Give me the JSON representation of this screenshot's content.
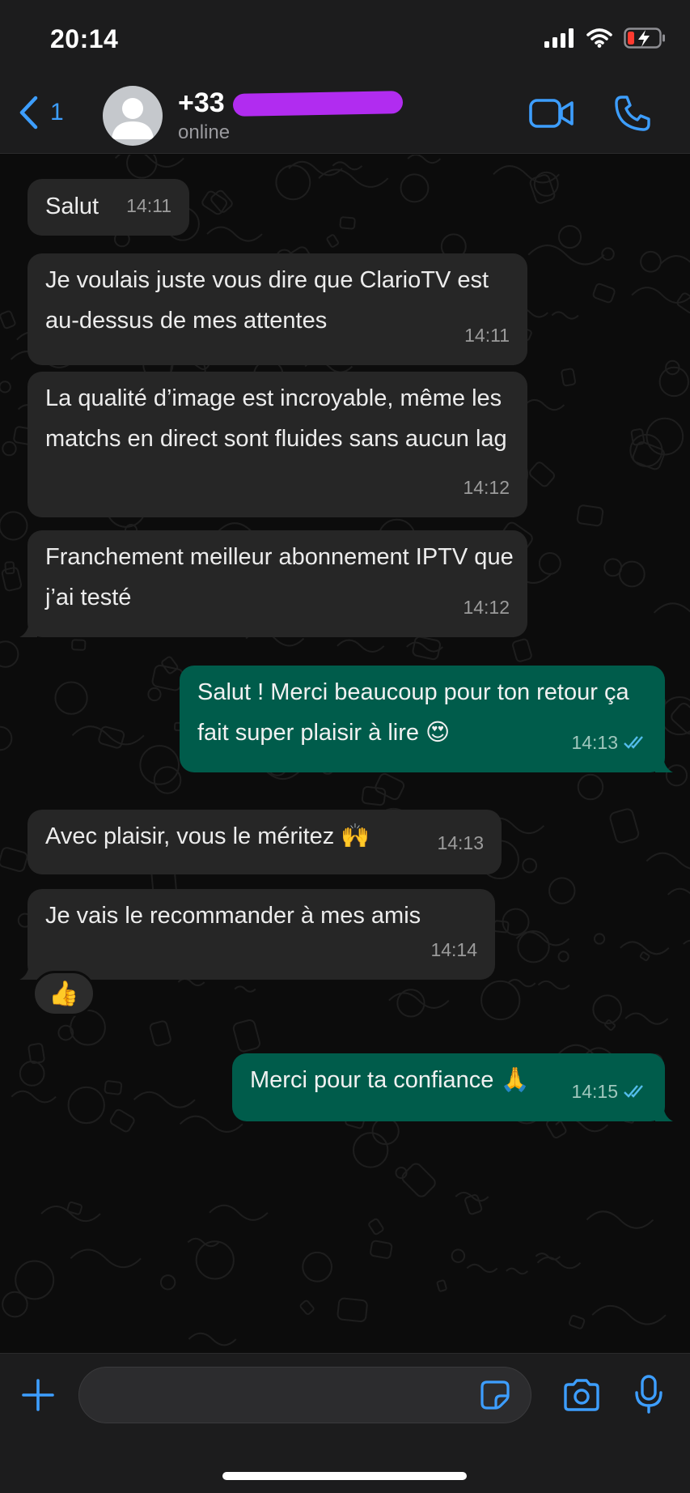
{
  "status_bar": {
    "time": "20:14"
  },
  "header": {
    "back_count": "1",
    "contact_name": "+33",
    "contact_status": "online"
  },
  "messages": [
    {
      "direction": "in",
      "text": "Salut",
      "time": "14:11"
    },
    {
      "direction": "in",
      "text": "Je voulais juste vous dire que ClarioTV est au-dessus de mes attentes",
      "time": "14:11"
    },
    {
      "direction": "in",
      "text": "La qualité d’image est incroyable, même les matchs en direct sont fluides sans aucun lag",
      "time": "14:12"
    },
    {
      "direction": "in",
      "text": "Franchement meilleur abonnement IPTV que j’ai testé",
      "time": "14:12"
    },
    {
      "direction": "out",
      "text": "Salut ! Merci beaucoup pour ton retour ça fait super plaisir à lire 😍",
      "time": "14:13",
      "read": true
    },
    {
      "direction": "in",
      "text": "Avec plaisir, vous le méritez 🙌",
      "time": "14:13"
    },
    {
      "direction": "in",
      "text": "Je vais le recommander à mes amis",
      "time": "14:14",
      "reaction": "👍"
    },
    {
      "direction": "out",
      "text": "Merci pour ta confiance 🙏",
      "time": "14:15",
      "read": true
    }
  ],
  "composer": {
    "value": ""
  },
  "colors": {
    "accent": "#3d9eff",
    "incoming_bubble": "#262626",
    "outgoing_bubble": "#005c4b",
    "read_ticks": "#53bdeb"
  }
}
